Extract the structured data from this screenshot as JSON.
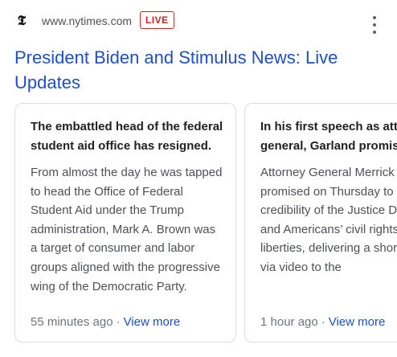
{
  "source": {
    "favicon_glyph": "𝕿",
    "domain": "www.nytimes.com",
    "live_label": "LIVE"
  },
  "title": "President Biden and Stimulus News: Live Updates",
  "icons": {
    "favicon": "nytimes-logo-icon",
    "menu": "more-vert-icon"
  },
  "colors": {
    "link": "#1f4fc1",
    "live": "#c5221f"
  },
  "cards": [
    {
      "headline": "The embattled head of the federal student aid office has resigned.",
      "body": "From almost the day he was tapped to head the Office of Federal Student Aid under the Trump administration, Mark A. Brown was a target of consumer and labor groups aligned with the progressive wing of the Democratic Party.",
      "time": "55 minutes ago",
      "separator": "·",
      "view_more": "View more"
    },
    {
      "headline": "In his first speech as attorney general, Garland promises",
      "body": "Attorney General Merrick Garland promised on Thursday to protect the credibility of the Justice Department and Americans’ civil rights and liberties, delivering a short speech via video to the",
      "time": "1 hour ago",
      "separator": "·",
      "view_more": "View more"
    }
  ]
}
